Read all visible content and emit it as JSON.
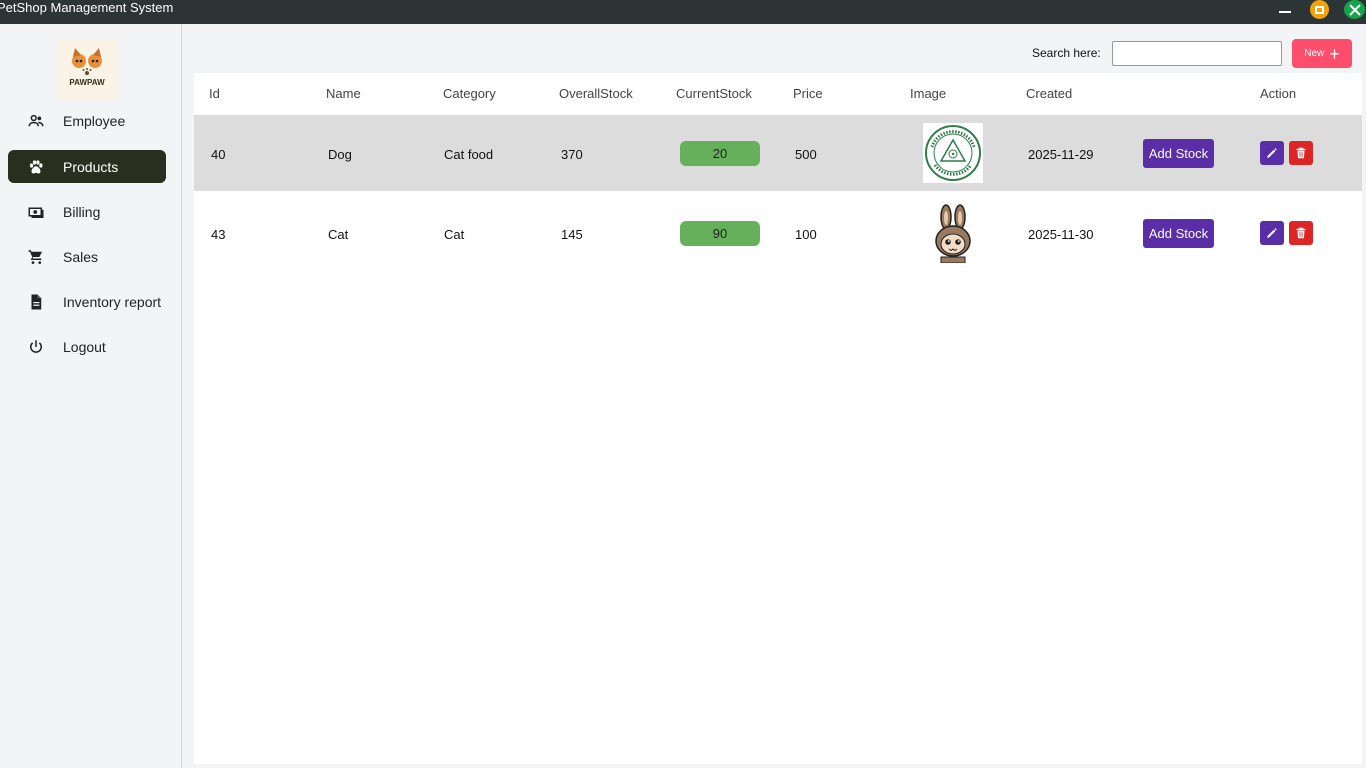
{
  "window": {
    "title": "PetShop Management System",
    "colors": {
      "titlebar": "#2d3436",
      "maximize": "#f0a30a",
      "close": "#16a34a"
    }
  },
  "sidebar": {
    "logo_text": "PAWPAW",
    "items": [
      {
        "label": "Employee",
        "icon": "users-icon",
        "active": false
      },
      {
        "label": "Products",
        "icon": "paw-icon",
        "active": true
      },
      {
        "label": "Billing",
        "icon": "money-icon",
        "active": false
      },
      {
        "label": "Sales",
        "icon": "cart-icon",
        "active": false
      },
      {
        "label": "Inventory report",
        "icon": "document-icon",
        "active": false
      },
      {
        "label": "Logout",
        "icon": "power-icon",
        "active": false
      }
    ]
  },
  "search": {
    "label": "Search here:",
    "value": "",
    "placeholder": ""
  },
  "new_button": {
    "label": "New",
    "icon": "plus-icon",
    "color": "#ff4d6d"
  },
  "table": {
    "headers": [
      "Id",
      "Name",
      "Category",
      "OverallStock",
      "CurrentStock",
      "Price",
      "Image",
      "Created",
      "",
      "Action"
    ],
    "add_stock_label": "Add Stock",
    "rows": [
      {
        "id": "40",
        "name": "Dog",
        "category": "Cat food",
        "overall": "370",
        "current": "20",
        "price": "500",
        "image": "university-seal-image",
        "created": "2025-11-29",
        "selected": true
      },
      {
        "id": "43",
        "name": "Cat",
        "category": "Cat",
        "overall": "145",
        "current": "90",
        "price": "100",
        "image": "bunny-character-image",
        "created": "2025-11-30",
        "selected": false
      }
    ],
    "colors": {
      "stock_pill": "#66b05b",
      "add_stock": "#5a2ea6",
      "edit": "#5a2ea6",
      "delete": "#dc2626",
      "selected_row": "#dcdcdc"
    }
  }
}
